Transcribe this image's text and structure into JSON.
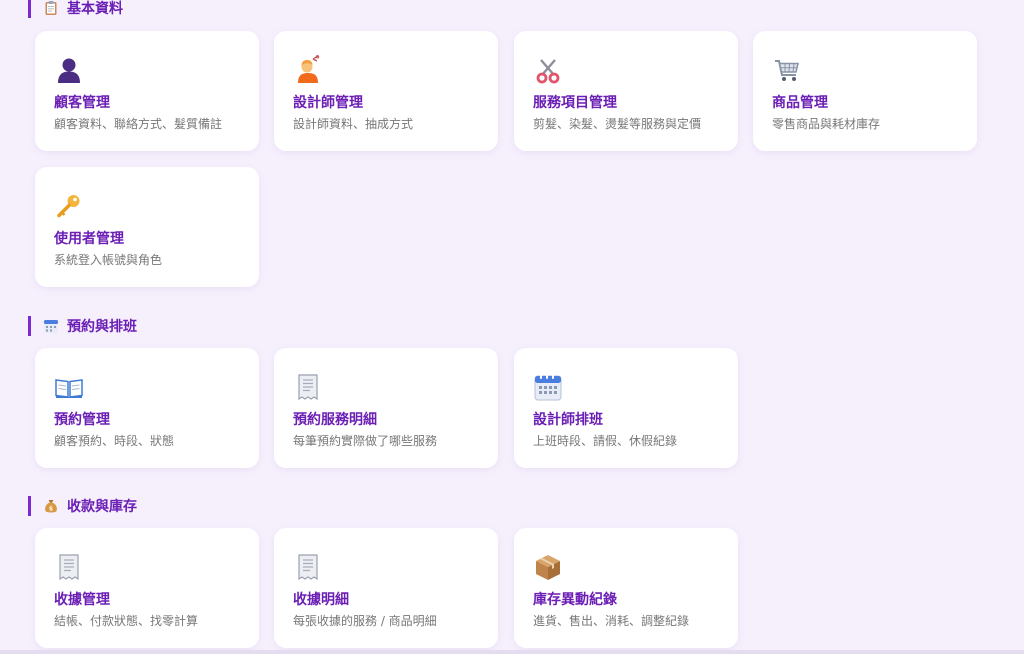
{
  "sections": [
    {
      "title": "基本資料",
      "icon": "clipboard-icon",
      "cards": [
        {
          "title": "顧客管理",
          "desc": "顧客資料、聯絡方式、髮質備註",
          "icon": "customer-silhouette-icon"
        },
        {
          "title": "設計師管理",
          "desc": "設計師資料、抽成方式",
          "icon": "hairdresser-icon"
        },
        {
          "title": "服務項目管理",
          "desc": "剪髮、染髮、燙髮等服務與定價",
          "icon": "scissors-icon"
        },
        {
          "title": "商品管理",
          "desc": "零售商品與耗材庫存",
          "icon": "shopping-cart-icon"
        },
        {
          "title": "使用者管理",
          "desc": "系統登入帳號與角色",
          "icon": "key-icon"
        }
      ]
    },
    {
      "title": "預約與排班",
      "icon": "calendar-icon",
      "cards": [
        {
          "title": "預約管理",
          "desc": "顧客預約、時段、狀態",
          "icon": "open-book-icon"
        },
        {
          "title": "預約服務明細",
          "desc": "每筆預約實際做了哪些服務",
          "icon": "receipt-icon"
        },
        {
          "title": "設計師排班",
          "desc": "上班時段、請假、休假紀錄",
          "icon": "calendar-icon"
        }
      ]
    },
    {
      "title": "收款與庫存",
      "icon": "money-bag-icon",
      "cards": [
        {
          "title": "收據管理",
          "desc": "結帳、付款狀態、找零計算",
          "icon": "receipt-icon"
        },
        {
          "title": "收據明細",
          "desc": "每張收據的服務 / 商品明細",
          "icon": "receipt-icon"
        },
        {
          "title": "庫存異動紀錄",
          "desc": "進貨、售出、消耗、調整紀錄",
          "icon": "package-icon"
        }
      ]
    }
  ]
}
